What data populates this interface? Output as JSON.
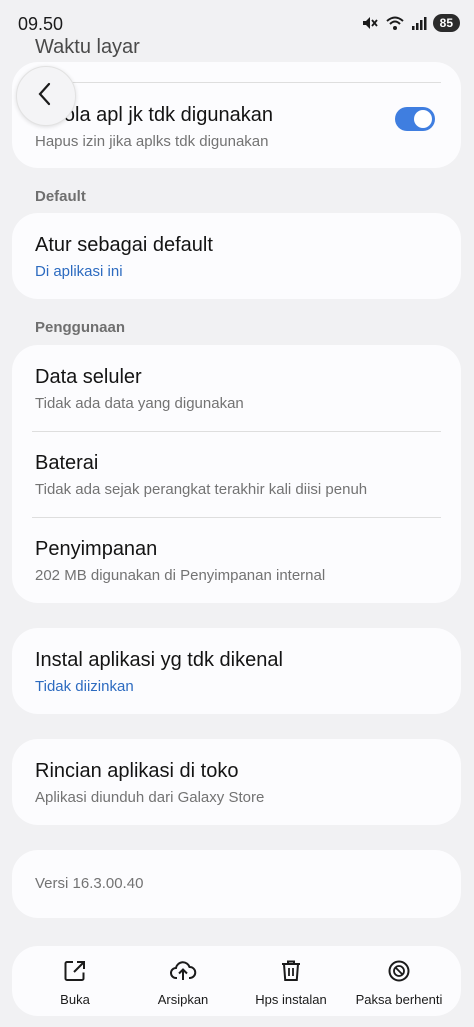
{
  "status_bar": {
    "time": "09.50",
    "battery": "85",
    "icons": [
      "mute-icon",
      "wifi-icon",
      "signal-icon"
    ]
  },
  "top": {
    "faded_title": "Waktu layar",
    "manage_unused": {
      "title": "Kelola apl jk tdk digunakan",
      "subtitle": "Hapus izin jika aplks tdk digunakan",
      "toggle_on": true
    }
  },
  "default_section": {
    "label": "Default",
    "set_default": {
      "title": "Atur sebagai default",
      "subtitle": "Di aplikasi ini"
    }
  },
  "usage_section": {
    "label": "Penggunaan",
    "items": [
      {
        "title": "Data seluler",
        "subtitle": "Tidak ada data yang digunakan"
      },
      {
        "title": "Baterai",
        "subtitle": "Tidak ada sejak perangkat terakhir kali diisi penuh"
      },
      {
        "title": "Penyimpanan",
        "subtitle": "202 MB digunakan di Penyimpanan internal"
      }
    ]
  },
  "install_unknown": {
    "title": "Instal aplikasi yg tdk dikenal",
    "subtitle": "Tidak diizinkan"
  },
  "store_details": {
    "title": "Rincian aplikasi di toko",
    "subtitle": "Aplikasi diunduh dari Galaxy Store"
  },
  "version": "Versi 16.3.00.40",
  "bottom_bar": {
    "open": "Buka",
    "archive": "Arsipkan",
    "uninstall": "Hps instalan",
    "force_stop": "Paksa berhenti"
  },
  "colors": {
    "accent": "#3f7ee0",
    "link": "#2d6bc0",
    "background": "#f1f1f3",
    "card": "#fcfcfe"
  }
}
